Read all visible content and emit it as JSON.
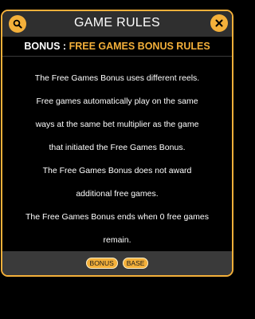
{
  "header": {
    "title": "GAME RULES",
    "search_icon": "search-icon",
    "close_icon": "close-icon"
  },
  "section": {
    "prefix": "BONUS : ",
    "title": "FREE GAMES BONUS RULES"
  },
  "content": {
    "lines": [
      "The Free Games Bonus uses different reels.",
      "Free games automatically play on the same",
      "ways at the same bet multiplier as the game",
      "that initiated the Free Games Bonus.",
      "The Free Games Bonus does not award",
      "additional free games.",
      "The Free Games Bonus ends when 0 free games",
      "remain."
    ]
  },
  "footer": {
    "tabs": [
      {
        "label": "BONUS"
      },
      {
        "label": "BASE"
      }
    ]
  },
  "colors": {
    "accent": "#f4b03a",
    "header_bg": "#2f2f2f",
    "footer_bg": "#3a3a3a",
    "background": "#000000",
    "text": "#ffffff"
  }
}
